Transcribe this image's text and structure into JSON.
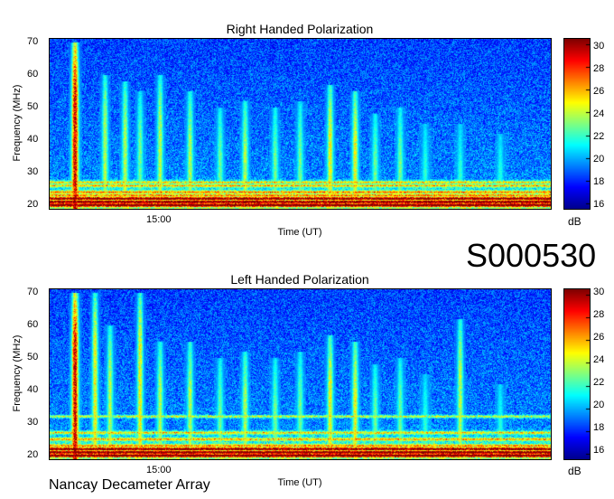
{
  "observation_id": "S000530",
  "instrument": "Nancay Decameter Array",
  "colors": {
    "colormap": [
      "#00008f",
      "#0000ff",
      "#0080ff",
      "#00ffff",
      "#80ff80",
      "#ffff00",
      "#ff8000",
      "#ff0000",
      "#800000"
    ],
    "background": "#ffffff"
  },
  "chart_data": [
    {
      "type": "heatmap",
      "title": "Right Handed Polarization",
      "xlabel": "Time (UT)",
      "ylabel": "Frequency (MHz)",
      "x_ticks": [
        "15:00"
      ],
      "y_ticks": [
        20,
        30,
        40,
        50,
        60,
        70
      ],
      "ylim": [
        19,
        71
      ],
      "colorbar": {
        "label": "dB",
        "ticks": [
          16,
          18,
          20,
          22,
          24,
          26,
          28,
          30
        ],
        "range": [
          15.5,
          30.5
        ]
      },
      "features": {
        "band_frequencies_mhz": [
          20,
          21,
          22,
          23,
          24,
          26,
          27
        ],
        "vertical_bursts": [
          {
            "t": 0.05,
            "fmax": 70,
            "level": 30
          },
          {
            "t": 0.11,
            "fmax": 60,
            "level": 24
          },
          {
            "t": 0.15,
            "fmax": 58,
            "level": 24
          },
          {
            "t": 0.18,
            "fmax": 55,
            "level": 23
          },
          {
            "t": 0.22,
            "fmax": 60,
            "level": 24
          },
          {
            "t": 0.28,
            "fmax": 55,
            "level": 24
          },
          {
            "t": 0.34,
            "fmax": 50,
            "level": 23
          },
          {
            "t": 0.39,
            "fmax": 52,
            "level": 24
          },
          {
            "t": 0.45,
            "fmax": 50,
            "level": 23
          },
          {
            "t": 0.5,
            "fmax": 52,
            "level": 23
          },
          {
            "t": 0.56,
            "fmax": 57,
            "level": 25
          },
          {
            "t": 0.61,
            "fmax": 55,
            "level": 25
          },
          {
            "t": 0.65,
            "fmax": 48,
            "level": 23
          },
          {
            "t": 0.7,
            "fmax": 50,
            "level": 23
          },
          {
            "t": 0.75,
            "fmax": 45,
            "level": 22
          },
          {
            "t": 0.82,
            "fmax": 45,
            "level": 22
          },
          {
            "t": 0.9,
            "fmax": 42,
            "level": 22
          }
        ]
      }
    },
    {
      "type": "heatmap",
      "title": "Left Handed Polarization",
      "xlabel": "Time (UT)",
      "ylabel": "Frequency (MHz)",
      "x_ticks": [
        "15:00"
      ],
      "y_ticks": [
        20,
        30,
        40,
        50,
        60,
        70
      ],
      "ylim": [
        19,
        71
      ],
      "colorbar": {
        "label": "dB",
        "ticks": [
          16,
          18,
          20,
          22,
          24,
          26,
          28,
          30
        ],
        "range": [
          15.5,
          30.5
        ]
      },
      "features": {
        "band_frequencies_mhz": [
          20,
          21,
          22,
          23,
          25,
          27,
          32
        ],
        "vertical_bursts": [
          {
            "t": 0.05,
            "fmax": 70,
            "level": 30
          },
          {
            "t": 0.09,
            "fmax": 70,
            "level": 25
          },
          {
            "t": 0.12,
            "fmax": 60,
            "level": 24
          },
          {
            "t": 0.18,
            "fmax": 70,
            "level": 25
          },
          {
            "t": 0.22,
            "fmax": 55,
            "level": 24
          },
          {
            "t": 0.28,
            "fmax": 55,
            "level": 24
          },
          {
            "t": 0.34,
            "fmax": 50,
            "level": 23
          },
          {
            "t": 0.39,
            "fmax": 52,
            "level": 24
          },
          {
            "t": 0.45,
            "fmax": 50,
            "level": 23
          },
          {
            "t": 0.5,
            "fmax": 52,
            "level": 23
          },
          {
            "t": 0.56,
            "fmax": 57,
            "level": 25
          },
          {
            "t": 0.61,
            "fmax": 55,
            "level": 25
          },
          {
            "t": 0.65,
            "fmax": 48,
            "level": 23
          },
          {
            "t": 0.7,
            "fmax": 50,
            "level": 23
          },
          {
            "t": 0.75,
            "fmax": 45,
            "level": 22
          },
          {
            "t": 0.82,
            "fmax": 62,
            "level": 24
          },
          {
            "t": 0.9,
            "fmax": 42,
            "level": 22
          }
        ]
      }
    }
  ]
}
